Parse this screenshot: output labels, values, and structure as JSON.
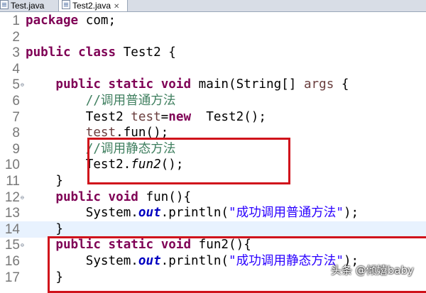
{
  "tabs": [
    {
      "label": "Test.java",
      "active": false
    },
    {
      "label": "Test2.java",
      "active": true,
      "close": "✕"
    }
  ],
  "editor": {
    "lines": [
      {
        "num": "1",
        "parts": [
          [
            "kw",
            "package"
          ],
          [
            "",
            "com;"
          ]
        ]
      },
      {
        "num": "2",
        "parts": []
      },
      {
        "num": "3",
        "parts": [
          [
            "kw",
            "public"
          ],
          [
            "kw",
            "class"
          ],
          [
            "",
            "Test2 {"
          ]
        ]
      },
      {
        "num": "4",
        "parts": []
      },
      {
        "num": "5",
        "parts": [
          [
            "",
            "    "
          ],
          [
            "kw",
            "public"
          ],
          [
            "kw",
            "static"
          ],
          [
            "kw",
            "void"
          ],
          [
            "",
            "main(String[] "
          ],
          [
            "var",
            "args"
          ],
          [
            "",
            " {"
          ]
        ]
      },
      {
        "num": "6",
        "parts": [
          [
            "",
            "        "
          ],
          [
            "cm",
            "//调用普通方法"
          ]
        ]
      },
      {
        "num": "7",
        "parts": [
          [
            "",
            "        Test2 "
          ],
          [
            "var",
            "test"
          ],
          [
            "",
            "="
          ],
          [
            "kw",
            "new"
          ],
          [
            "",
            " Test2();"
          ]
        ]
      },
      {
        "num": "8",
        "parts": [
          [
            "",
            "        "
          ],
          [
            "var",
            "test"
          ],
          [
            "",
            ".fun();"
          ]
        ]
      },
      {
        "num": "9",
        "parts": [
          [
            "",
            "        "
          ],
          [
            "cm",
            "//调用静态方法"
          ]
        ]
      },
      {
        "num": "10",
        "parts": [
          [
            "",
            "        Test2."
          ],
          [
            "sm",
            "fun2"
          ],
          [
            "",
            "();"
          ]
        ]
      },
      {
        "num": "11",
        "parts": [
          [
            "",
            "    }"
          ]
        ]
      },
      {
        "num": "12",
        "parts": [
          [
            "",
            "    "
          ],
          [
            "kw",
            "public"
          ],
          [
            "kw",
            "void"
          ],
          [
            "",
            "fun(){"
          ]
        ]
      },
      {
        "num": "13",
        "parts": [
          [
            "",
            "        System."
          ],
          [
            "fld",
            "out"
          ],
          [
            "",
            ".println("
          ],
          [
            "str",
            "\"成功调用普通方法\""
          ],
          [
            "",
            ");"
          ]
        ]
      },
      {
        "num": "14",
        "parts": [
          [
            "",
            "    }"
          ]
        ]
      },
      {
        "num": "15",
        "parts": [
          [
            "",
            "    "
          ],
          [
            "kw",
            "public"
          ],
          [
            "kw",
            "static"
          ],
          [
            "kw",
            "void"
          ],
          [
            "",
            "fun2(){"
          ]
        ]
      },
      {
        "num": "16",
        "parts": [
          [
            "",
            "        System."
          ],
          [
            "fld",
            "out"
          ],
          [
            "",
            ".println("
          ],
          [
            "str",
            "\"成功调用静态方法\""
          ],
          [
            "",
            ");"
          ]
        ]
      },
      {
        "num": "17",
        "parts": [
          [
            "",
            "    }"
          ]
        ]
      }
    ],
    "highlighted_line": "14",
    "fold_lines": [
      "5",
      "12",
      "15"
    ],
    "fold_glyph": "⊖"
  },
  "annotations": {
    "color": "#d0121b"
  },
  "watermark": "头条 @倾嬉baby"
}
